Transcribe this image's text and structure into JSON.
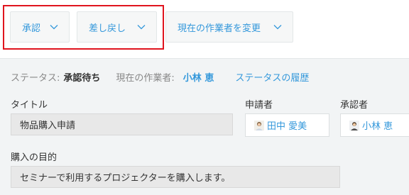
{
  "actions": [
    {
      "label": "承認"
    },
    {
      "label": "差し戻し"
    },
    {
      "label": "現在の作業者を変更"
    }
  ],
  "status": {
    "status_label": "ステータス:",
    "status_value": "承認待ち",
    "assignee_label": "現在の作業者:",
    "assignee_value": "小林 恵",
    "history_link": "ステータスの履歴"
  },
  "fields": {
    "title_label": "タイトル",
    "title_value": "物品購入申請",
    "applicant_label": "申請者",
    "applicant_value": "田中 愛美",
    "approver_label": "承認者",
    "approver_value": "小林 恵",
    "purpose_label": "購入の目的",
    "purpose_value": "セミナーで利用するプロジェクターを購入します。"
  },
  "colors": {
    "accent": "#3498db",
    "highlight": "#e0141e"
  },
  "icons": {
    "dropdown": "chevron-down-icon",
    "applicant_avatar": "user-avatar-icon",
    "approver_avatar": "user-avatar-icon"
  }
}
